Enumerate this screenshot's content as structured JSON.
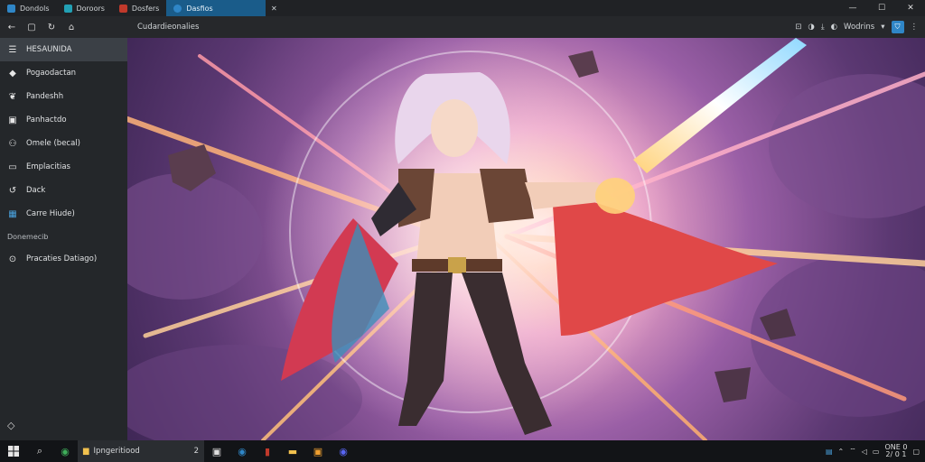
{
  "tabs": [
    {
      "label": "Dondols",
      "icon": "globe-icon",
      "color": "#2f86c7"
    },
    {
      "label": "Doroors",
      "icon": "edge-icon",
      "color": "#22a0b4"
    },
    {
      "label": "Dosfers",
      "icon": "app-icon",
      "color": "#c0392b"
    },
    {
      "label": "Dasfios",
      "icon": "edge-icon",
      "color": "#2f86c7",
      "active": true
    }
  ],
  "window_controls": {
    "minimize": "—",
    "maximize": "☐",
    "close": "✕"
  },
  "addressbar": {
    "back": "←",
    "address": "Cudardieonalies",
    "right_items": [
      "Wodrins"
    ]
  },
  "sidebar": {
    "items": [
      {
        "label": "HESAUNIDA",
        "icon": "menu-icon",
        "glyph": "☰",
        "active": true
      },
      {
        "label": "Pogaodactan",
        "icon": "cube-icon",
        "glyph": "◆"
      },
      {
        "label": "Pandeshh",
        "icon": "leaf-icon",
        "glyph": "❦"
      },
      {
        "label": "Panhactdo",
        "icon": "image-icon",
        "glyph": "▣"
      },
      {
        "label": "Omele (becal)",
        "icon": "people-icon",
        "glyph": "⚇"
      },
      {
        "label": "Emplacitias",
        "icon": "display-icon",
        "glyph": "▭"
      },
      {
        "label": "Dack",
        "icon": "swirl-icon",
        "glyph": "↺"
      },
      {
        "label": "Carre Hiude)",
        "icon": "grid-icon",
        "glyph": "▦"
      }
    ],
    "section_header": "Donemecib",
    "footer_item": {
      "label": "Pracaties Datiago)",
      "icon": "power-icon",
      "glyph": "⊙"
    },
    "bottom_icon": {
      "icon": "diamond-icon",
      "glyph": "◇"
    }
  },
  "taskbar": {
    "app_label": "Ipngeritiood",
    "app_num": "2",
    "clock_time": "ONE 0",
    "clock_date": "2/ 0 1"
  },
  "colors": {
    "accent": "#1a5c8a",
    "sidebar_bg": "#24272a",
    "taskbar_bg": "#121417"
  }
}
